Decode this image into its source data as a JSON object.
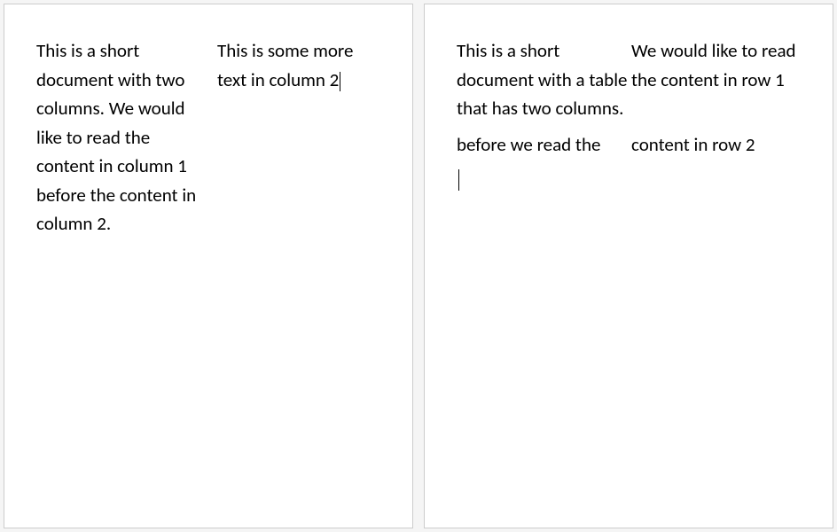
{
  "page1": {
    "col1": "This is a short document with two columns. We would like to read the content in column 1 before the content in column 2.",
    "col2": "This is some more text in column 2"
  },
  "page2": {
    "row1": {
      "cell1": "This is a short document with a table that has two columns.",
      "cell2": "We would like to read the content in row 1"
    },
    "row2": {
      "cell1": "before we read the",
      "cell2": "content in row 2"
    }
  }
}
